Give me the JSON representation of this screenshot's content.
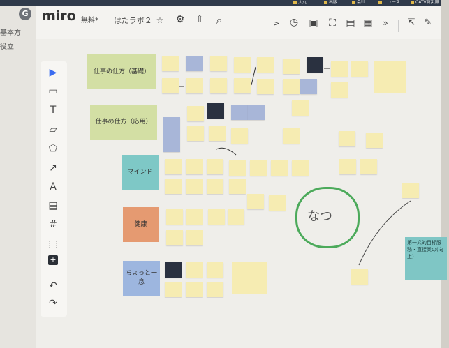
{
  "browser": {
    "bookmarks": [
      "大丸",
      "出版",
      "会社",
      "ニュース",
      "CATV防災無"
    ],
    "left_panel_lines": [
      "基本方",
      "役立"
    ]
  },
  "toolbar": {
    "app_logo": "miro",
    "plan_badge": "無料*",
    "board_name": "はたラボ２",
    "star_icon": "☆",
    "settings_icon": "⚙",
    "share_icon": "⇧",
    "search_icon": "⌕",
    "right_icons": [
      ">",
      "◷",
      "▣",
      "⛶",
      "▤",
      "▦",
      "»"
    ]
  },
  "left_tools": [
    "▶",
    "▭",
    "T",
    "▱",
    "⬠",
    "↗",
    "A",
    "▤",
    "#",
    "⬚",
    "+",
    "↶",
    "↷"
  ],
  "sections": [
    {
      "label": "仕事の仕方（基礎）"
    },
    {
      "label": "仕事の仕方（応用）"
    },
    {
      "label": "マインド"
    },
    {
      "label": "健康"
    },
    {
      "label": "ちょっと一息"
    }
  ],
  "colors": {
    "section_green": "#d3dfa4",
    "section_teal": "#7ec8c6",
    "section_orange": "#e59a71",
    "section_blue": "#9db6df",
    "sticky_yellow": "#f6ecb2",
    "sticky_blue": "#a8b6d8",
    "sticky_dark": "#2a3140",
    "handwriting_green": "#4caa5b"
  },
  "handwriting": "なつ",
  "teal_note_text": "第一义的目标服務・直接業の(向上)"
}
